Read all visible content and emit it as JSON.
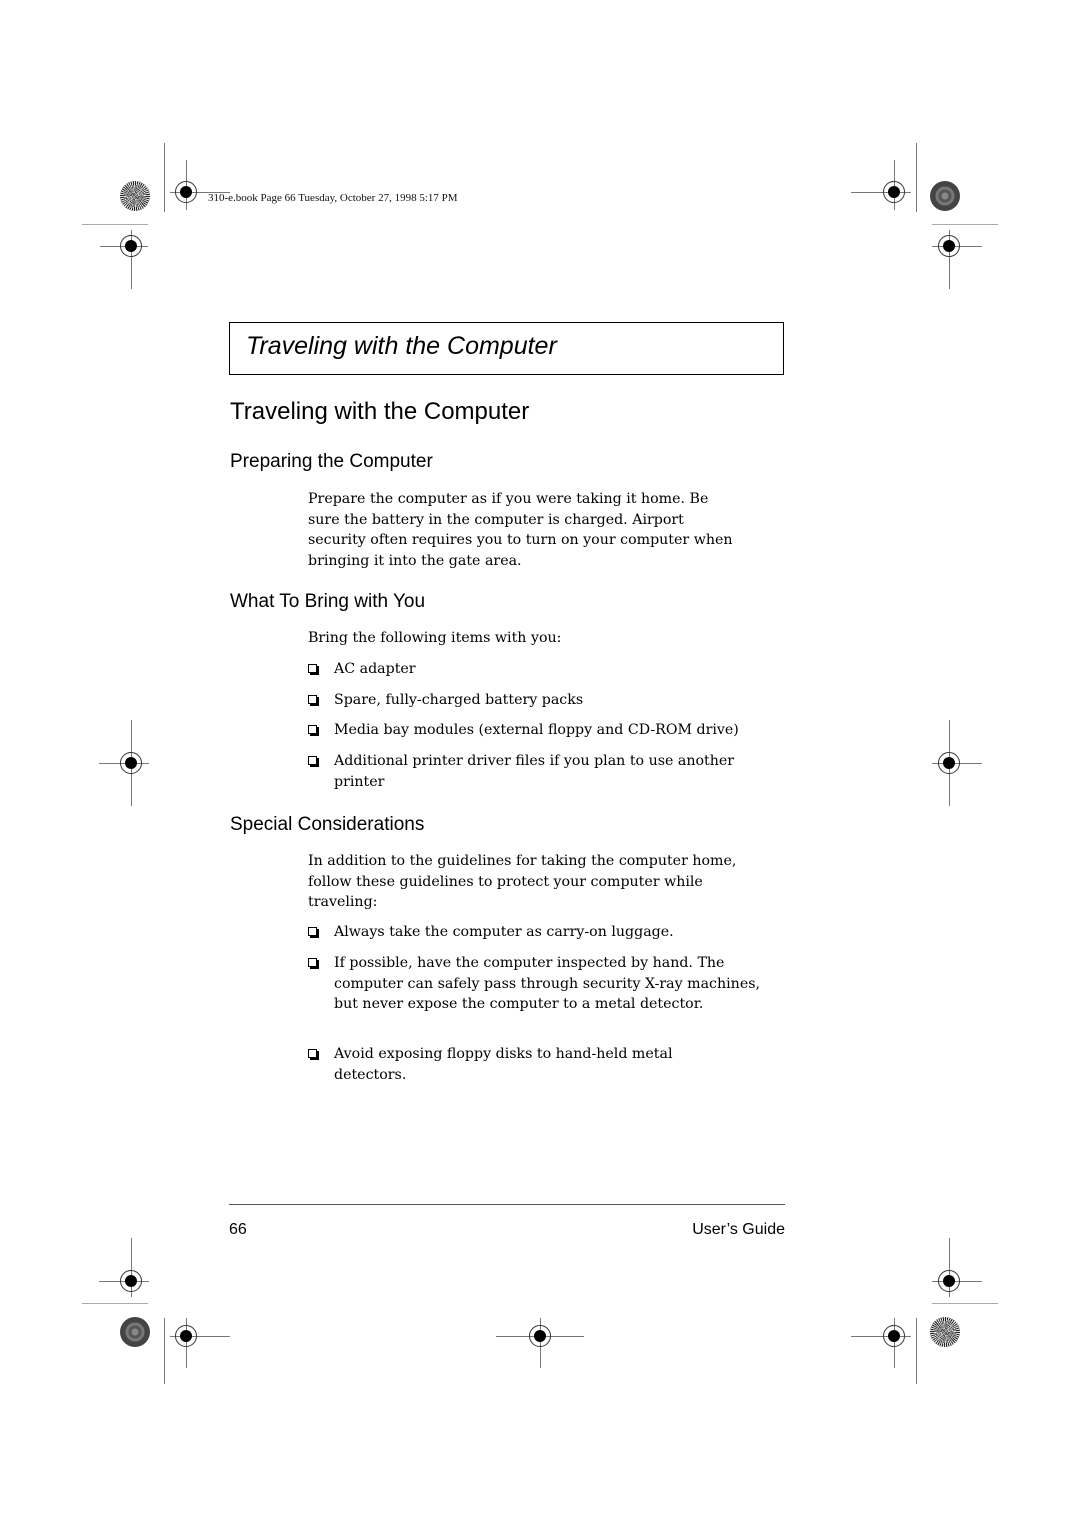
{
  "print_meta": "310-e.book  Page 66  Tuesday, October 27, 1998  5:17 PM",
  "chapter_header": "Traveling with the Computer",
  "page_title": "Traveling with the Computer",
  "sections": {
    "preparing": {
      "heading": "Preparing the Computer",
      "lines": [
        "Prepare the computer as if you were taking it home.  Be",
        "sure the battery in the computer is charged.  Airport",
        "security often requires you to turn on your computer when",
        "bringing it into the gate area."
      ]
    },
    "bring": {
      "heading": "What To Bring with You",
      "intro": "Bring the following items with you:",
      "items": [
        "AC adapter",
        "Spare, fully-charged battery packs",
        "Media bay modules (external floppy and CD-ROM drive)",
        "Additional printer driver files if you plan to use another printer"
      ]
    },
    "special": {
      "heading": "Special Considerations",
      "intro_lines": [
        "In addition to the guidelines for taking the computer home,",
        "follow these guidelines to protect your computer while",
        "traveling:"
      ],
      "items": [
        "Always take the computer as carry-on luggage.",
        "If possible, have the computer inspected by hand.  The computer can safely pass through security X-ray machines, but never expose the computer to a metal detector.",
        "Avoid exposing floppy disks to hand-held metal detectors."
      ]
    }
  },
  "footer": {
    "page_number": "66",
    "book_title": "User’s Guide"
  }
}
